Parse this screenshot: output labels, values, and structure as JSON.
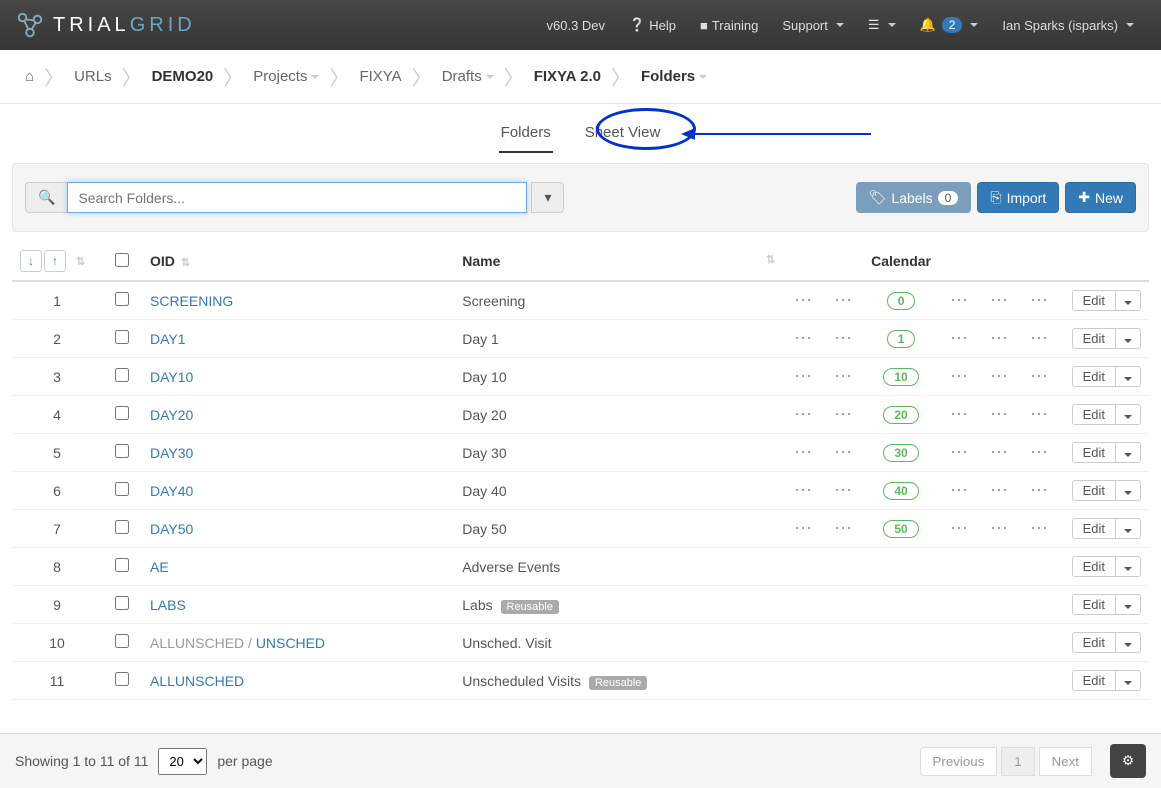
{
  "topbar": {
    "brand_left": "TRIAL",
    "brand_right": "GRID",
    "version": "v60.3 Dev",
    "help": "Help",
    "training": "Training",
    "support": "Support",
    "notif_count": "2",
    "user": "Ian Sparks (isparks)"
  },
  "breadcrumb": {
    "home_icon": "⌂",
    "urls": "URLs",
    "demo": "DEMO20",
    "projects": "Projects",
    "fixya": "FIXYA",
    "drafts": "Drafts",
    "fixya2": "FIXYA 2.0",
    "folders": "Folders"
  },
  "tabs": {
    "folders": "Folders",
    "sheet_view": "Sheet View"
  },
  "toolbar": {
    "search_placeholder": "Search Folders...",
    "labels": "Labels",
    "labels_count": "0",
    "import": "Import",
    "new": "New"
  },
  "columns": {
    "oid": "OID",
    "name": "Name",
    "calendar": "Calendar"
  },
  "rows": [
    {
      "idx": "1",
      "oid": "SCREENING",
      "name": "Screening",
      "cal": "0",
      "has_cal": true,
      "reusable": false,
      "prefix": ""
    },
    {
      "idx": "2",
      "oid": "DAY1",
      "name": "Day 1",
      "cal": "1",
      "has_cal": true,
      "reusable": false,
      "prefix": ""
    },
    {
      "idx": "3",
      "oid": "DAY10",
      "name": "Day 10",
      "cal": "10",
      "has_cal": true,
      "reusable": false,
      "prefix": ""
    },
    {
      "idx": "4",
      "oid": "DAY20",
      "name": "Day 20",
      "cal": "20",
      "has_cal": true,
      "reusable": false,
      "prefix": ""
    },
    {
      "idx": "5",
      "oid": "DAY30",
      "name": "Day 30",
      "cal": "30",
      "has_cal": true,
      "reusable": false,
      "prefix": ""
    },
    {
      "idx": "6",
      "oid": "DAY40",
      "name": "Day 40",
      "cal": "40",
      "has_cal": true,
      "reusable": false,
      "prefix": ""
    },
    {
      "idx": "7",
      "oid": "DAY50",
      "name": "Day 50",
      "cal": "50",
      "has_cal": true,
      "reusable": false,
      "prefix": ""
    },
    {
      "idx": "8",
      "oid": "AE",
      "name": "Adverse Events",
      "cal": "",
      "has_cal": false,
      "reusable": false,
      "prefix": ""
    },
    {
      "idx": "9",
      "oid": "LABS",
      "name": "Labs",
      "cal": "",
      "has_cal": false,
      "reusable": true,
      "prefix": ""
    },
    {
      "idx": "10",
      "oid": "UNSCHED",
      "name": "Unsched. Visit",
      "cal": "",
      "has_cal": false,
      "reusable": false,
      "prefix": "ALLUNSCHED / "
    },
    {
      "idx": "11",
      "oid": "ALLUNSCHED",
      "name": "Unscheduled Visits",
      "cal": "",
      "has_cal": false,
      "reusable": true,
      "prefix": ""
    }
  ],
  "edit_label": "Edit",
  "reusable_label": "Reusable",
  "footer": {
    "showing": "Showing 1 to 11 of 11",
    "per_page_value": "20",
    "per_page_label": "per page",
    "prev": "Previous",
    "page": "1",
    "next": "Next"
  }
}
